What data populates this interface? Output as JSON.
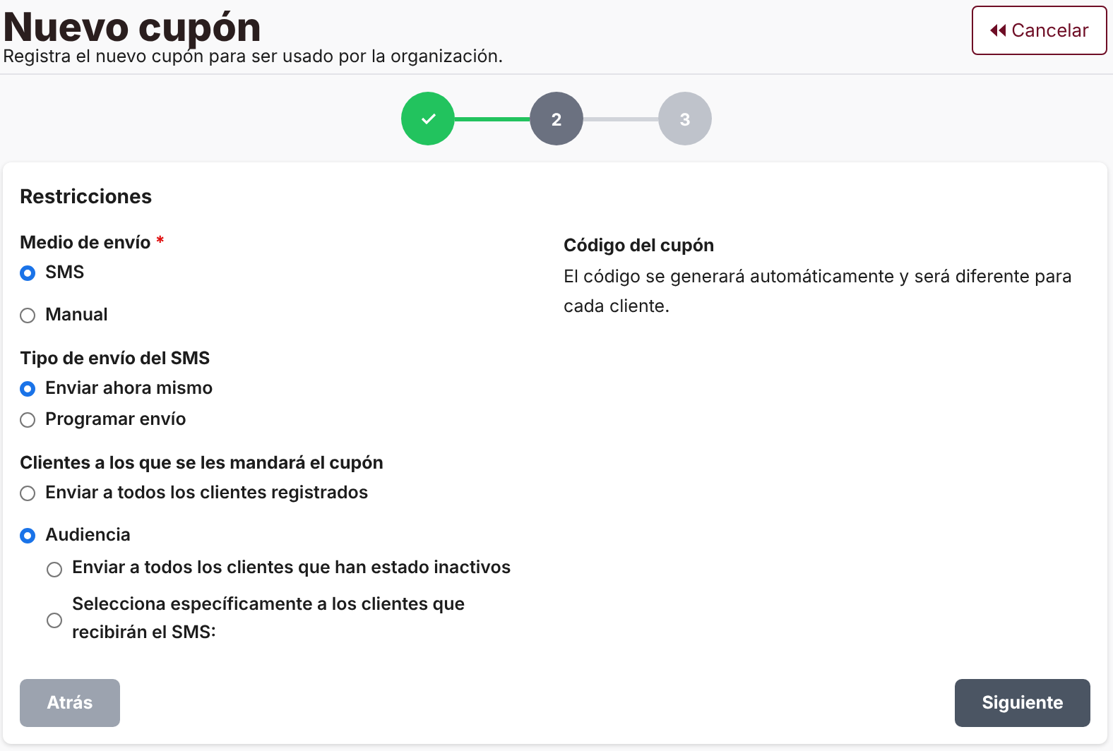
{
  "header": {
    "title": "Nuevo cupón",
    "subtitle": "Registra el nuevo cupón para ser usado por la organización.",
    "cancel_button": "Cancelar"
  },
  "steps": [
    {
      "done": true,
      "selected": false
    },
    {
      "done": false,
      "selected": true,
      "label": "2"
    },
    {
      "done": false,
      "selected": false,
      "label": "3"
    }
  ],
  "card": {
    "title": "Restricciones",
    "groups": [
      {
        "title": "Medio de envío",
        "required_mark": "*",
        "options": [
          {
            "label": "SMS",
            "selected": true
          },
          {
            "label": "Manual",
            "selected": false
          }
        ]
      },
      {
        "title": "Tipo de envío del SMS",
        "options": [
          {
            "label": "Enviar ahora mismo",
            "selected": true
          },
          {
            "label": "Programar envío",
            "selected": false
          }
        ]
      },
      {
        "title": "Clientes a los que se les mandará el cupón",
        "options": [
          {
            "label": "Enviar a todos los clientes registrados",
            "selected": false
          },
          {
            "label": "Audiencia",
            "selected": true,
            "children": [
              {
                "label": "Enviar a todos los clientes que han estado inactivos",
                "selected": false
              },
              {
                "label": "Selecciona específicamente a los clientes que recibirán el SMS:",
                "selected": false
              }
            ]
          }
        ]
      }
    ],
    "info": {
      "title": "Código del cupón",
      "text": "El código se generará automáticamente y será diferente para cada cliente."
    },
    "buttons": [
      {
        "label": "Atrás",
        "disabled": true
      },
      {
        "label": "Siguiente",
        "disabled": false
      }
    ]
  }
}
